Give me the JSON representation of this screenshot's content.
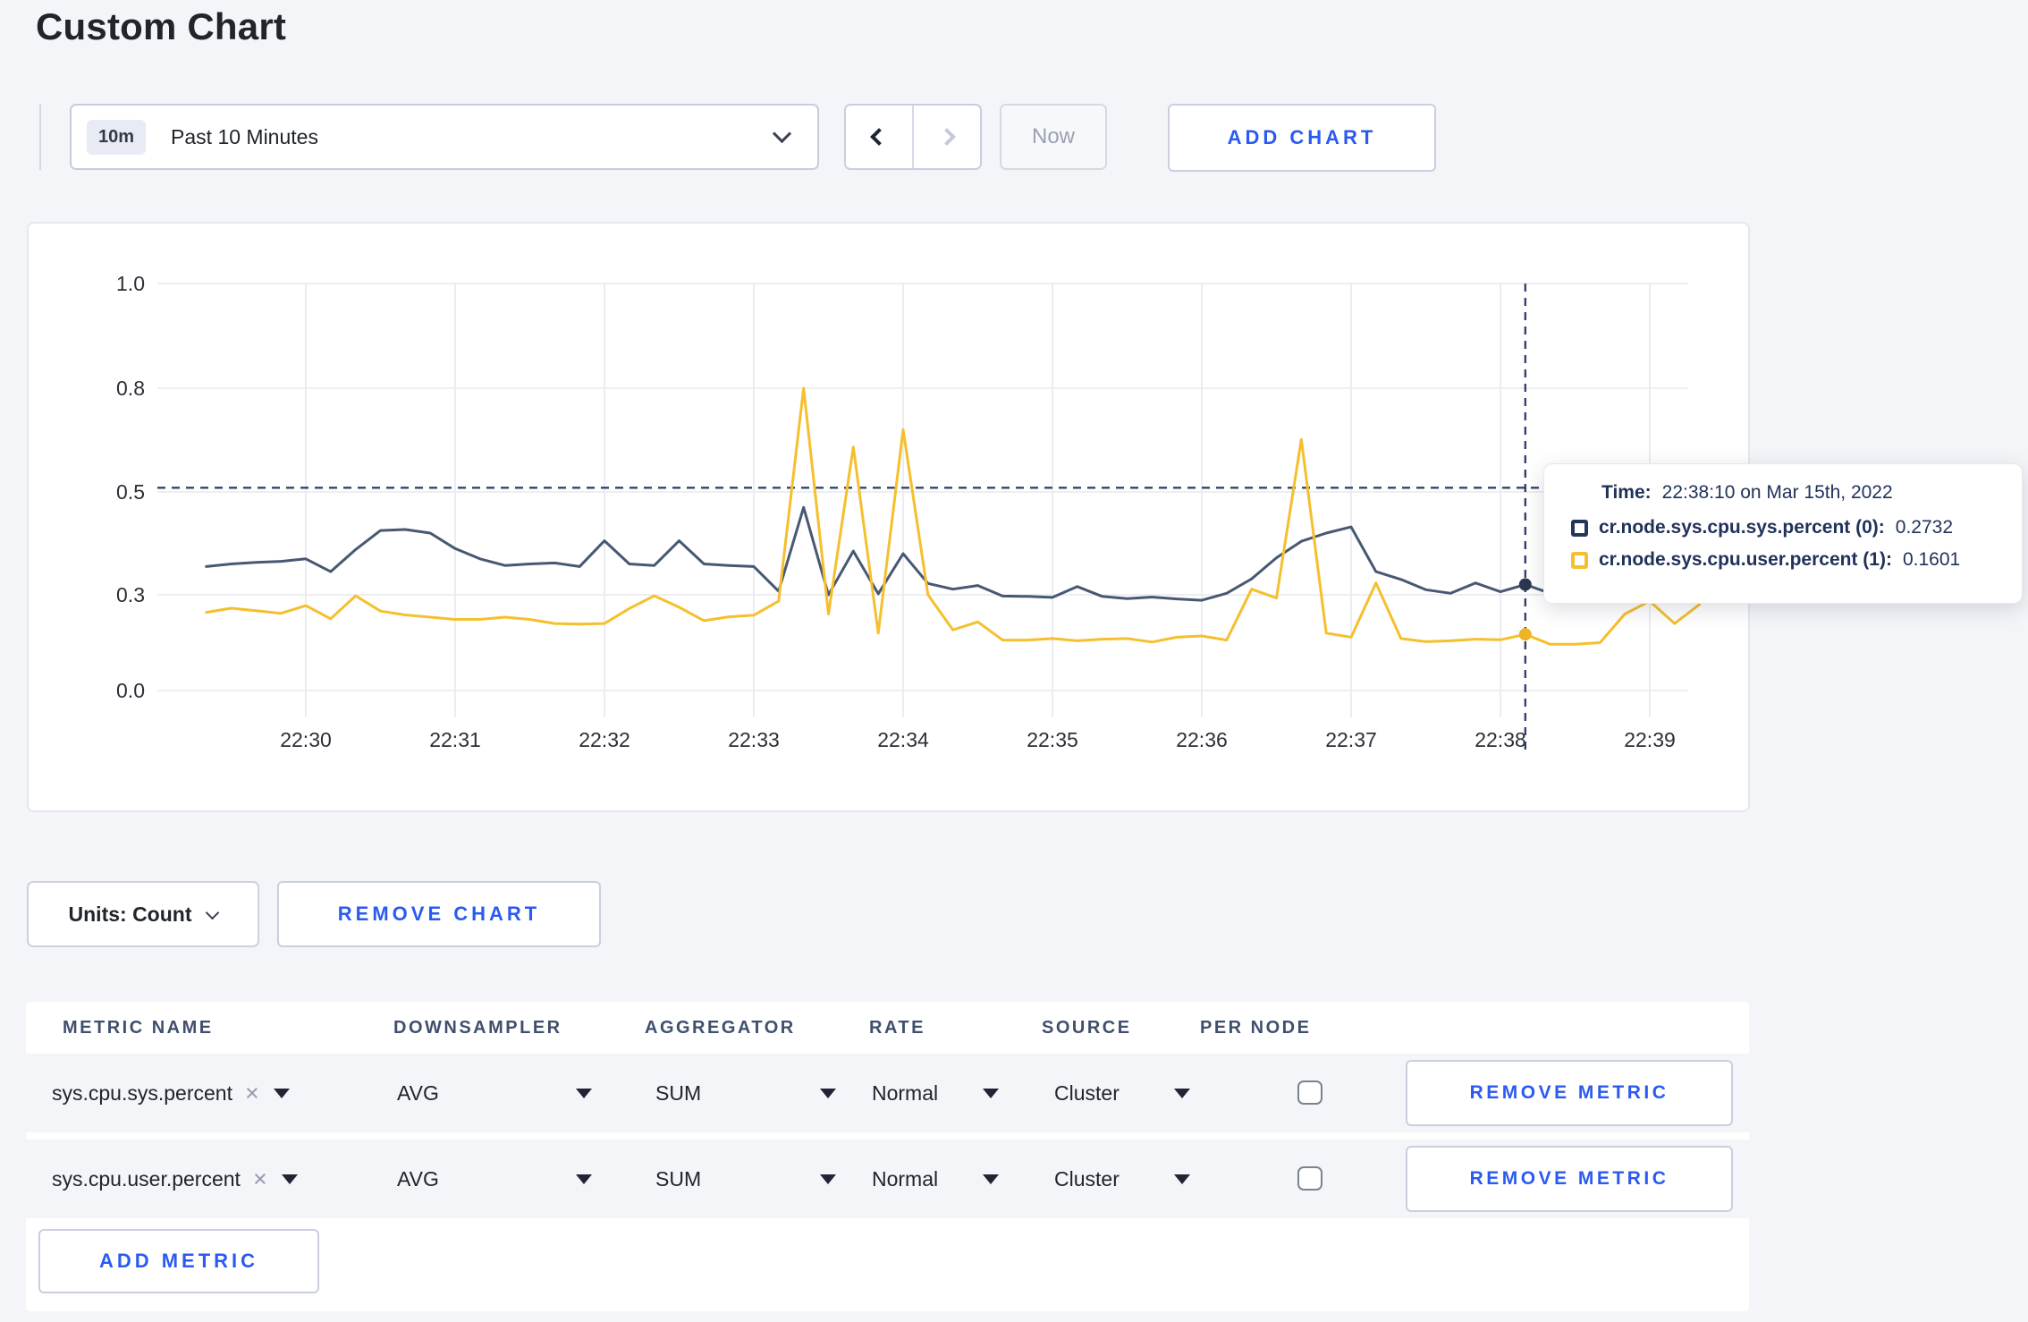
{
  "page": {
    "title": "Custom Chart"
  },
  "toolbar": {
    "range_badge": "10m",
    "range_label": "Past 10 Minutes",
    "now_label": "Now",
    "add_chart_label": "ADD CHART"
  },
  "icons": {
    "close": "×"
  },
  "chart_data": {
    "type": "line",
    "title": "",
    "xlabel": "",
    "ylabel": "",
    "x_tick_labels": [
      "22:30",
      "22:31",
      "22:32",
      "22:33",
      "22:34",
      "22:35",
      "22:36",
      "22:37",
      "22:38",
      "22:39"
    ],
    "y_tick_labels": [
      "0.0",
      "0.3",
      "0.5",
      "0.8",
      "1.0"
    ],
    "y_tick_values": [
      0.0,
      0.3,
      0.5,
      0.8,
      1.0
    ],
    "grid": true,
    "legend_position": "tooltip",
    "start_offset_seconds": -40,
    "interval_seconds": 10,
    "series": [
      {
        "name": "cr.node.sys.cpu.sys.percent",
        "color": "#475872",
        "dot_color": "#2b3752",
        "values": [
          0.355,
          0.36,
          0.363,
          0.365,
          0.37,
          0.345,
          0.388,
          0.425,
          0.427,
          0.42,
          0.39,
          0.37,
          0.357,
          0.36,
          0.362,
          0.355,
          0.405,
          0.36,
          0.357,
          0.405,
          0.36,
          0.357,
          0.355,
          0.307,
          0.47,
          0.3,
          0.385,
          0.302,
          0.38,
          0.322,
          0.311,
          0.318,
          0.296,
          0.295,
          0.292,
          0.316,
          0.295,
          0.288,
          0.293,
          0.287,
          0.283,
          0.303,
          0.331,
          0.372,
          0.404,
          0.42,
          0.432,
          0.345,
          0.33,
          0.31,
          0.303,
          0.323,
          0.306,
          0.32,
          0.303,
          0.31,
          0.315,
          0.308,
          0.3,
          0.305,
          0.303
        ]
      },
      {
        "name": "cr.node.sys.cpu.user.percent",
        "color": "#f5bf2d",
        "dot_color": "#f0b423",
        "values": [
          0.245,
          0.258,
          0.25,
          0.242,
          0.266,
          0.225,
          0.297,
          0.249,
          0.237,
          0.23,
          0.223,
          0.223,
          0.23,
          0.223,
          0.21,
          0.208,
          0.21,
          0.257,
          0.297,
          0.261,
          0.219,
          0.231,
          0.236,
          0.28,
          0.8,
          0.24,
          0.63,
          0.18,
          0.68,
          0.3,
          0.19,
          0.215,
          0.158,
          0.158,
          0.163,
          0.156,
          0.161,
          0.163,
          0.152,
          0.167,
          0.171,
          0.158,
          0.311,
          0.29,
          0.652,
          0.18,
          0.167,
          0.323,
          0.163,
          0.153,
          0.156,
          0.161,
          0.159,
          0.176,
          0.145,
          0.145,
          0.15,
          0.24,
          0.28,
          0.21,
          0.27
        ]
      }
    ],
    "crosshair": {
      "time": "22:38:10",
      "minute_offset": 8.1667,
      "point_index": 53,
      "hline_value": 0.512
    }
  },
  "tooltip": {
    "time_label": "Time:",
    "time_value": "22:38:10 on Mar 15th, 2022",
    "rows": [
      {
        "label": "cr.node.sys.cpu.sys.percent (0):",
        "value": "0.2732",
        "swatch_color": "#25355c"
      },
      {
        "label": "cr.node.sys.cpu.user.percent (1):",
        "value": "0.1601",
        "swatch_color": "#f5bf2d"
      }
    ]
  },
  "chart_controls": {
    "units_label": "Units: Count",
    "remove_chart_label": "REMOVE CHART"
  },
  "metrics_table": {
    "headers": [
      "METRIC NAME",
      "DOWNSAMPLER",
      "AGGREGATOR",
      "RATE",
      "SOURCE",
      "PER NODE"
    ],
    "rows": [
      {
        "metric": "sys.cpu.sys.percent",
        "downsampler": "AVG",
        "aggregator": "SUM",
        "rate": "Normal",
        "source": "Cluster",
        "per_node": false,
        "remove_label": "REMOVE METRIC"
      },
      {
        "metric": "sys.cpu.user.percent",
        "downsampler": "AVG",
        "aggregator": "SUM",
        "rate": "Normal",
        "source": "Cluster",
        "per_node": false,
        "remove_label": "REMOVE METRIC"
      }
    ],
    "add_metric_label": "ADD METRIC"
  }
}
